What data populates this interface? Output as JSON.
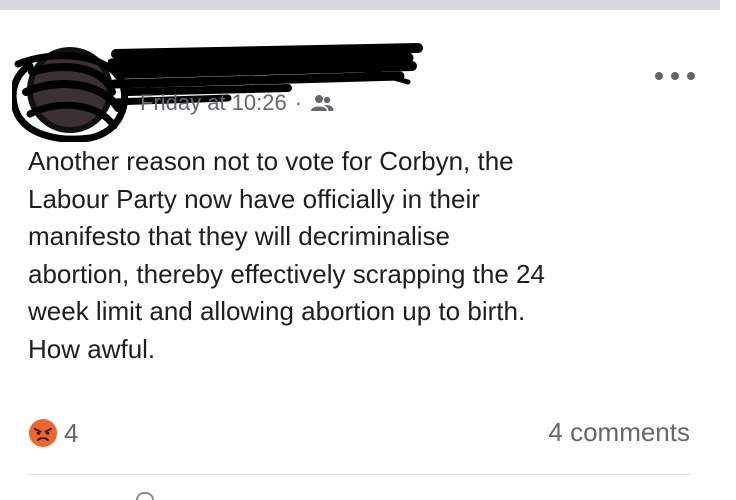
{
  "post": {
    "meta": {
      "timestamp": "Friday at 10:26",
      "separator": "·",
      "audience_icon": "friends-icon"
    },
    "more_icon": "more-horizontal-icon",
    "body_lines": [
      "Another reason not to vote for Corbyn, the",
      "Labour Party now have officially in their",
      "manifesto that they will decriminalise",
      "abortion, thereby effectively scrapping the 24",
      "week limit and allowing abortion up to birth.",
      "How awful."
    ],
    "reactions": {
      "icon": "angry-reaction-icon",
      "count": "4"
    },
    "comments": {
      "label": "4 comments"
    }
  },
  "colors": {
    "divider": "#d6d8dc",
    "meta_text": "#65676b",
    "body_text": "#1c1e21",
    "angry_face": "#f0662a"
  }
}
